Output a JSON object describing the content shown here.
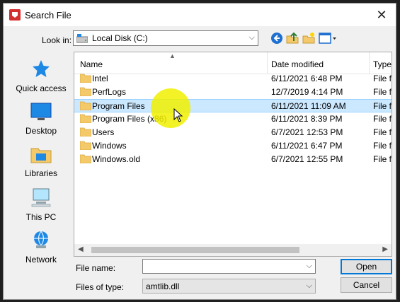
{
  "window": {
    "title": "Search File",
    "close_glyph": "✕"
  },
  "lookin": {
    "label": "Look in:",
    "value": "Local Disk (C:)"
  },
  "toolbar": {
    "icons": [
      "back-icon",
      "up-folder-icon",
      "new-folder-icon",
      "view-menu-icon"
    ]
  },
  "places": [
    {
      "label": "Quick access",
      "icon": "quick-access-icon"
    },
    {
      "label": "Desktop",
      "icon": "desktop-icon"
    },
    {
      "label": "Libraries",
      "icon": "libraries-icon"
    },
    {
      "label": "This PC",
      "icon": "this-pc-icon"
    },
    {
      "label": "Network",
      "icon": "network-icon"
    }
  ],
  "columns": {
    "name": "Name",
    "date": "Date modified",
    "type": "Type"
  },
  "files": [
    {
      "name": "Intel",
      "date": "6/11/2021 6:48 PM",
      "type": "File fo"
    },
    {
      "name": "PerfLogs",
      "date": "12/7/2019 4:14 PM",
      "type": "File fo"
    },
    {
      "name": "Program Files",
      "date": "6/11/2021 11:09 AM",
      "type": "File fo",
      "selected": true
    },
    {
      "name": "Program Files (x86)",
      "date": "6/11/2021 8:39 PM",
      "type": "File fo"
    },
    {
      "name": "Users",
      "date": "6/7/2021 12:53 PM",
      "type": "File fo"
    },
    {
      "name": "Windows",
      "date": "6/11/2021 6:47 PM",
      "type": "File fo"
    },
    {
      "name": "Windows.old",
      "date": "6/7/2021 12:55 PM",
      "type": "File fo"
    }
  ],
  "filename": {
    "label": "File name:",
    "value": ""
  },
  "filetype": {
    "label": "Files of type:",
    "value": "amtlib.dll"
  },
  "buttons": {
    "open": "Open",
    "cancel": "Cancel"
  },
  "colors": {
    "selection": "#cce8ff",
    "accent": "#0078d7",
    "folder": "#f4c96a",
    "highlight": "#f0f000"
  }
}
